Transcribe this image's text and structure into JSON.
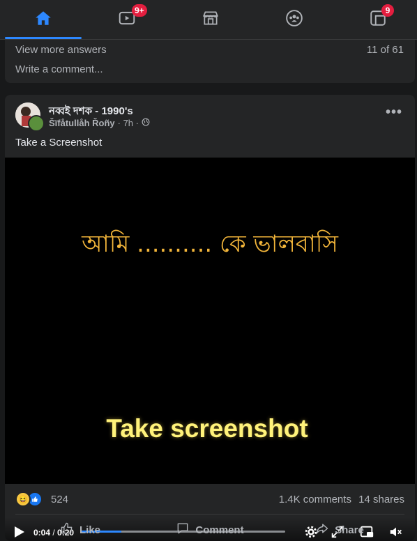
{
  "nav": {
    "watch_badge": "9+",
    "menu_badge": "9"
  },
  "prev_post": {
    "view_more": "View more answers",
    "count": "11 of 61",
    "write_comment": "Write a comment..."
  },
  "post": {
    "group_name": "নব্বই দশক - 1990's",
    "author": "Šïfåtullåh Řoñy",
    "time": "· 7h ·",
    "caption": "Take a Screenshot",
    "video": {
      "overlay_text_1": "আমি .......... কে ভালবাসি",
      "overlay_text_2": "Take screenshot",
      "current_time": "0:04",
      "separator": " / ",
      "duration": "0:20",
      "progress": 0.2
    },
    "reaction_count": "524",
    "comments": "1.4K comments",
    "shares": "14 shares",
    "actions": {
      "like": "Like",
      "comment": "Comment",
      "share": "Share"
    }
  },
  "colors": {
    "accent": "#2d88ff",
    "badge": "#e41e3f",
    "card": "#242526",
    "background": "#18191a"
  }
}
